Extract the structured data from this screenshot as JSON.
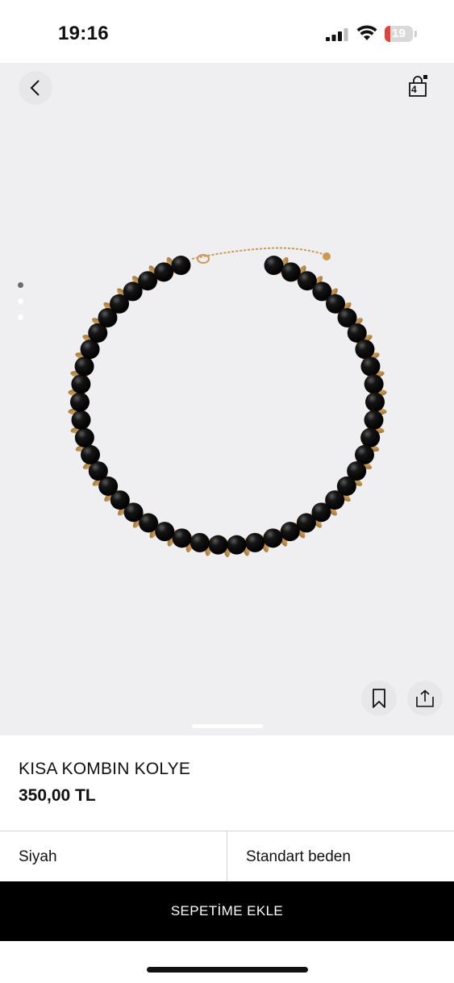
{
  "status_bar": {
    "time": "19:16",
    "battery_level": "19"
  },
  "hero": {
    "cart_count": "4",
    "image_dots_count": 3,
    "active_dot": 0,
    "icons": {
      "back": "chevron-left-icon",
      "cart": "shopping-bag-icon",
      "bookmark": "bookmark-icon",
      "share": "share-icon"
    }
  },
  "product": {
    "name": "KISA KOMBIN KOLYE",
    "price": "350,00 TL"
  },
  "options": {
    "color": "Siyah",
    "size": "Standart beden"
  },
  "actions": {
    "add_to_cart": "SEPETİME EKLE"
  },
  "colors": {
    "accent": "#000000",
    "bead": "#0d0d0d",
    "gold": "#c99a55",
    "hero_bg": "#efeff1",
    "battery_low": "#e0433b"
  }
}
